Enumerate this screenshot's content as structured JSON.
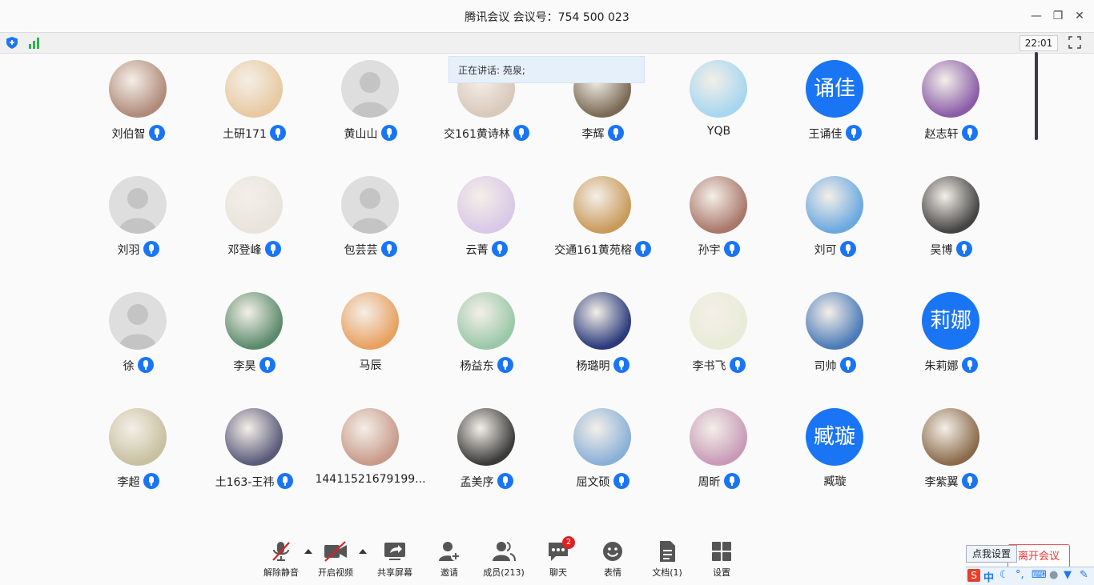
{
  "window": {
    "title": "腾讯会议 会议号：754 500 023"
  },
  "status": {
    "time": "22:01"
  },
  "speaking": "正在讲话: 苑泉;",
  "participants": [
    {
      "name": "刘伯智",
      "mic": true,
      "avatar": "photo",
      "color": "#b08a7a"
    },
    {
      "name": "土研171",
      "mic": true,
      "avatar": "photo",
      "color": "#e8c9a0"
    },
    {
      "name": "黄山山",
      "mic": true,
      "avatar": "default",
      "color": "#dedede"
    },
    {
      "name": "交161黄诗林",
      "mic": true,
      "avatar": "photo",
      "color": "#d9c8bb"
    },
    {
      "name": "李辉",
      "mic": true,
      "avatar": "photo",
      "color": "#7a6a55"
    },
    {
      "name": "YQB",
      "mic": false,
      "avatar": "photo",
      "color": "#a6d6f0"
    },
    {
      "name": "王诵佳",
      "mic": true,
      "avatar": "text",
      "text": "诵佳",
      "color": "#1a75f5"
    },
    {
      "name": "赵志轩",
      "mic": true,
      "avatar": "photo",
      "color": "#8a5ca8"
    },
    {
      "name": "刘羽",
      "mic": true,
      "avatar": "default",
      "color": "#dedede"
    },
    {
      "name": "邓登峰",
      "mic": true,
      "avatar": "photo",
      "color": "#e8e4dc"
    },
    {
      "name": "包芸芸",
      "mic": true,
      "avatar": "default",
      "color": "#dedede"
    },
    {
      "name": "云菁",
      "mic": true,
      "avatar": "photo",
      "color": "#d9c8e8"
    },
    {
      "name": "交通161黄苑榕",
      "mic": true,
      "avatar": "photo",
      "color": "#c99a5a"
    },
    {
      "name": "孙宇",
      "mic": true,
      "avatar": "photo",
      "color": "#a9776a"
    },
    {
      "name": "刘可",
      "mic": true,
      "avatar": "photo",
      "color": "#6aa8e0"
    },
    {
      "name": "吴博",
      "mic": true,
      "avatar": "photo",
      "color": "#444444"
    },
    {
      "name": "徐",
      "mic": true,
      "avatar": "default",
      "color": "#dedede"
    },
    {
      "name": "李昊",
      "mic": true,
      "avatar": "photo",
      "color": "#5a8a6a"
    },
    {
      "name": "马辰",
      "mic": false,
      "avatar": "photo",
      "color": "#e8a060"
    },
    {
      "name": "杨益东",
      "mic": true,
      "avatar": "photo",
      "color": "#9ac8a8"
    },
    {
      "name": "杨璐明",
      "mic": true,
      "avatar": "photo",
      "color": "#2a3a7a"
    },
    {
      "name": "李书飞",
      "mic": true,
      "avatar": "photo",
      "color": "#e8ecd8"
    },
    {
      "name": "司帅",
      "mic": true,
      "avatar": "photo",
      "color": "#4a7ab8"
    },
    {
      "name": "朱莉娜",
      "mic": true,
      "avatar": "text",
      "text": "莉娜",
      "color": "#1a75f5"
    },
    {
      "name": "李超",
      "mic": true,
      "avatar": "photo",
      "color": "#c8c0a0"
    },
    {
      "name": "土163-王祎",
      "mic": true,
      "avatar": "photo",
      "color": "#5a5a7a"
    },
    {
      "name": "14411521679199...",
      "mic": false,
      "avatar": "photo",
      "color": "#c89a8a"
    },
    {
      "name": "孟美序",
      "mic": true,
      "avatar": "photo",
      "color": "#3a3a3a"
    },
    {
      "name": "屈文硕",
      "mic": true,
      "avatar": "photo",
      "color": "#8ab0d8"
    },
    {
      "name": "周昕",
      "mic": true,
      "avatar": "photo",
      "color": "#c89ab8"
    },
    {
      "name": "臧璇",
      "mic": false,
      "avatar": "text",
      "text": "臧璇",
      "color": "#1a75f5"
    },
    {
      "name": "李紫翼",
      "mic": true,
      "avatar": "photo",
      "color": "#8a6a4a"
    }
  ],
  "toolbar": [
    {
      "label": "解除静音",
      "icon": "mic-muted-icon",
      "name": "unmute-button"
    },
    {
      "label": "开启视频",
      "icon": "video-off-icon",
      "name": "start-video-button"
    },
    {
      "label": "共享屏幕",
      "icon": "share-screen-icon",
      "name": "share-screen-button"
    },
    {
      "label": "邀请",
      "icon": "invite-icon",
      "name": "invite-button"
    },
    {
      "label": "成员(213)",
      "icon": "members-icon",
      "name": "members-button"
    },
    {
      "label": "聊天",
      "icon": "chat-icon",
      "name": "chat-button",
      "badge": "2"
    },
    {
      "label": "表情",
      "icon": "emoji-icon",
      "name": "emoji-button"
    },
    {
      "label": "文档(1)",
      "icon": "document-icon",
      "name": "document-button"
    },
    {
      "label": "设置",
      "icon": "settings-icon",
      "name": "settings-button"
    }
  ],
  "leave_label": "离开会议",
  "tooltip": "点我设置",
  "ime": {
    "lang": "中"
  },
  "colors": {
    "accent": "#1a75f5",
    "danger": "#e33333"
  }
}
